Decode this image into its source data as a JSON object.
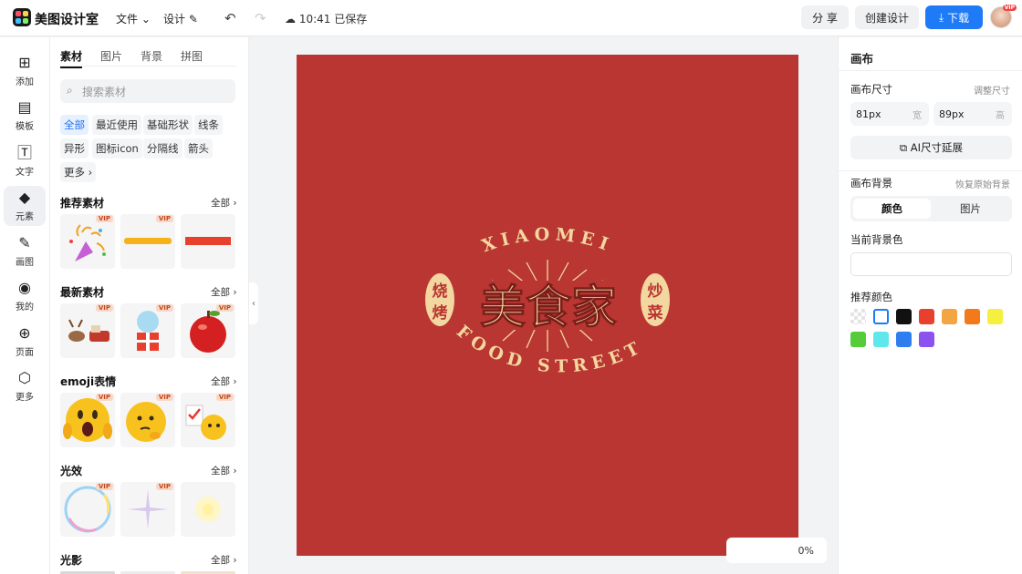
{
  "app": {
    "name": "美图设计室"
  },
  "header": {
    "file_menu": "文件",
    "design_menu": "设计",
    "saved_status": "10:41 已保存",
    "share_label": "分 享",
    "create_label": "创建设计",
    "download_label": "下载",
    "avatar_badge": "VIP"
  },
  "leftnav": {
    "items": [
      {
        "label": "添加",
        "icon": "plus-square-icon"
      },
      {
        "label": "模板",
        "icon": "template-icon"
      },
      {
        "label": "文字",
        "icon": "text-icon"
      },
      {
        "label": "元素",
        "icon": "shapes-icon"
      },
      {
        "label": "画图",
        "icon": "draw-icon"
      },
      {
        "label": "我的",
        "icon": "user-icon"
      },
      {
        "label": "页面",
        "icon": "page-add-icon"
      },
      {
        "label": "更多",
        "icon": "cube-icon"
      }
    ]
  },
  "panel": {
    "tabs": [
      "素材",
      "图片",
      "背景",
      "拼图"
    ],
    "search_placeholder": "搜索素材",
    "chips": [
      "全部",
      "最近使用",
      "基础形状",
      "线条",
      "异形",
      "图标icon",
      "分隔线",
      "箭头",
      "更多"
    ],
    "all_label": "全部",
    "vip": "VIP",
    "sections": [
      "推荐素材",
      "最新素材",
      "emoji表情",
      "光效",
      "光影"
    ]
  },
  "canvas": {
    "bg_color": "#b93632",
    "arc_top": "XIAOMEI",
    "arc_bottom": "FOOD STREET",
    "main_title": "美食家",
    "left_badge": [
      "烧",
      "烤"
    ],
    "right_badge": [
      "炒",
      "菜"
    ],
    "zoom": "0%"
  },
  "right_panel": {
    "title": "画布",
    "size_label": "画布尺寸",
    "resize_link": "调整尺寸",
    "width_value": "81px",
    "width_unit": "宽",
    "height_value": "89px",
    "height_unit": "高",
    "ai_extend": "AI尺寸延展",
    "bg_label": "画布背景",
    "restore_link": "恢复原始背景",
    "seg_color": "颜色",
    "seg_image": "图片",
    "current_bg_label": "当前背景色",
    "recommended_label": "推荐颜色",
    "colors": [
      "#eaeaea",
      "#ffffff",
      "#111111",
      "#e8402d",
      "#f4a543",
      "#f27a1a",
      "#f7ef3e",
      "#56cc3b",
      "#5ee8ec",
      "#2f7ef0",
      "#8c52f0"
    ]
  }
}
